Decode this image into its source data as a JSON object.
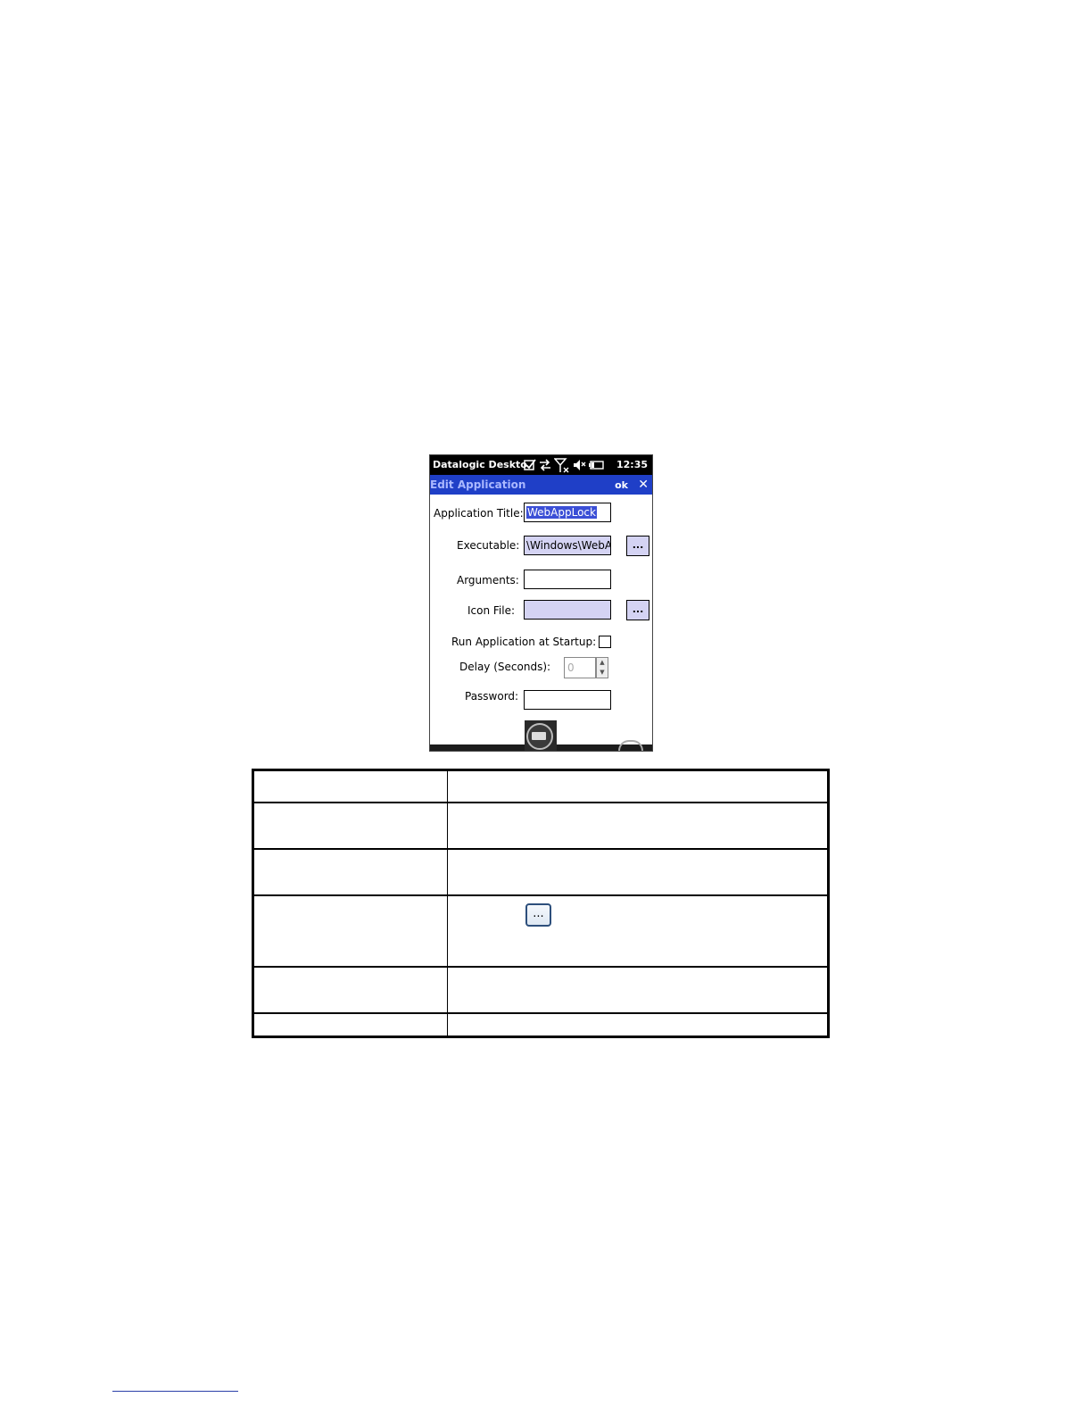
{
  "status_bar": {
    "app_name": "Datalogic Deskto",
    "time": "12:35",
    "icons": [
      "checkbox-icon",
      "sync-arrows-icon",
      "no-signal-icon",
      "speaker-muted-icon",
      "battery-icon"
    ]
  },
  "title_bar": {
    "title": "Edit Application",
    "ok_label": "ok",
    "close_label": "✕"
  },
  "form": {
    "app_title_label": "Application Title:",
    "app_title_value": "WebAppLock",
    "executable_label": "Executable:",
    "executable_value": "\\Windows\\WebA",
    "browse_label": "...",
    "arguments_label": "Arguments:",
    "arguments_value": "",
    "icon_file_label": "Icon File:",
    "icon_file_value": "",
    "run_at_startup_label": "Run Application at Startup:",
    "run_at_startup_checked": false,
    "delay_label": "Delay (Seconds):",
    "delay_value": "0",
    "password_label": "Password:",
    "password_value": ""
  },
  "table": {
    "inline_browse_label": "..."
  },
  "colors": {
    "title_bar": "#1f3fc7",
    "field_lavender": "#d4d3f3",
    "selection": "#3b4fd6"
  }
}
